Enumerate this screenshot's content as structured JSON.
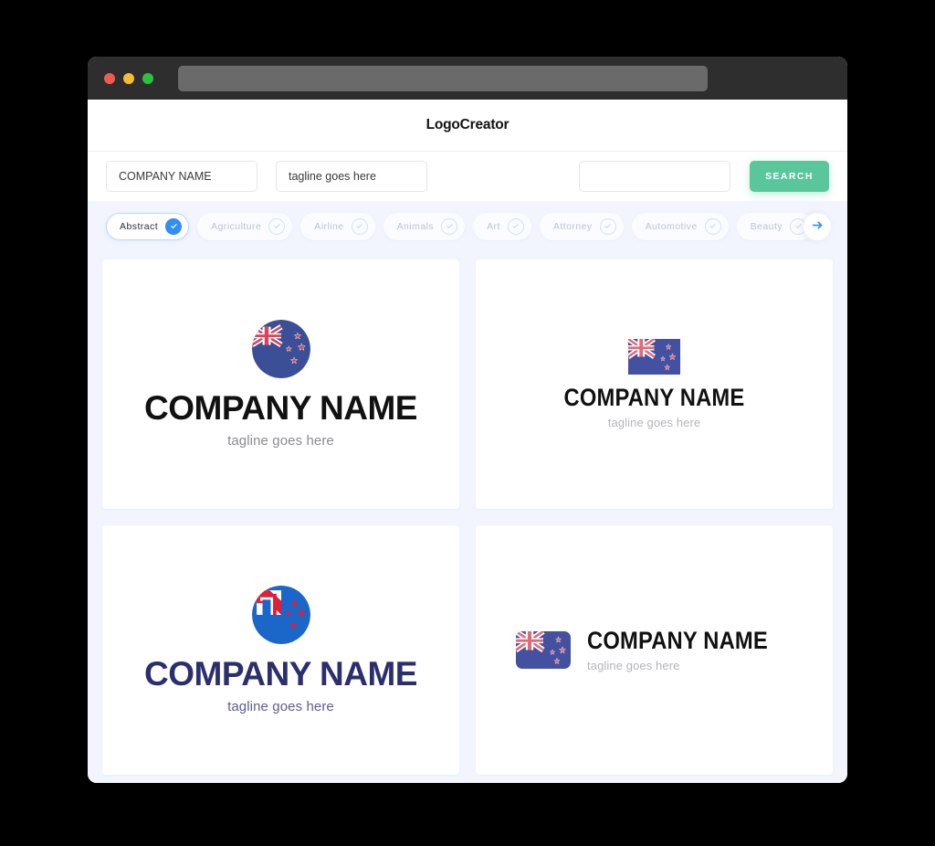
{
  "window": {
    "traffic_lights": [
      "close",
      "minimize",
      "maximize"
    ],
    "url_value": ""
  },
  "header": {
    "brand": "LogoCreator"
  },
  "search": {
    "company_value": "COMPANY NAME",
    "company_placeholder": "COMPANY NAME",
    "tagline_value": "tagline goes here",
    "tagline_placeholder": "tagline goes here",
    "keyword_value": "",
    "keyword_placeholder": "",
    "button_label": "SEARCH",
    "button_color": "#5ac69c"
  },
  "categories": {
    "active_index": 0,
    "next_icon": "arrow-right-icon",
    "accent_color": "#2f8ff5",
    "items": [
      {
        "label": "Abstract",
        "selected": true
      },
      {
        "label": "Agriculture",
        "selected": false
      },
      {
        "label": "Airline",
        "selected": false
      },
      {
        "label": "Animals",
        "selected": false
      },
      {
        "label": "Art",
        "selected": false
      },
      {
        "label": "Attorney",
        "selected": false
      },
      {
        "label": "Automotive",
        "selected": false
      },
      {
        "label": "Beauty",
        "selected": false
      }
    ]
  },
  "results": {
    "cards": [
      {
        "id": "logo-card-1",
        "layout": "vertical",
        "icon": "new-zealand-flag-circle-icon",
        "name": "COMPANY NAME",
        "tagline": "tagline goes here",
        "name_color": "#111111",
        "tagline_color": "#8b8b90",
        "flag_blue": "#3b4f96",
        "flag_red": "#d8455b",
        "flag_white": "#ffffff"
      },
      {
        "id": "logo-card-2",
        "layout": "vertical",
        "icon": "new-zealand-flag-rect-icon",
        "name": "COMPANY NAME",
        "tagline": "tagline goes here",
        "name_color": "#111111",
        "tagline_color": "#b5b5ba",
        "flag_blue": "#4351a0",
        "flag_red": "#e36a78",
        "flag_white": "#ffffff"
      },
      {
        "id": "logo-card-3",
        "layout": "vertical",
        "icon": "new-zealand-flag-abstract-circle-icon",
        "name": "COMPANY NAME",
        "tagline": "tagline goes here",
        "name_color": "#2b2f6e",
        "tagline_color": "#5a5f90",
        "flag_blue": "#1a66c9",
        "flag_red": "#e01e37",
        "flag_white": "#ffffff"
      },
      {
        "id": "logo-card-4",
        "layout": "horizontal",
        "icon": "new-zealand-flag-rounded-icon",
        "name": "COMPANY NAME",
        "tagline": "tagline goes here",
        "name_color": "#111111",
        "tagline_color": "#b5b5ba",
        "flag_blue": "#4351a0",
        "flag_red": "#e36a78",
        "flag_white": "#ffffff"
      }
    ]
  }
}
